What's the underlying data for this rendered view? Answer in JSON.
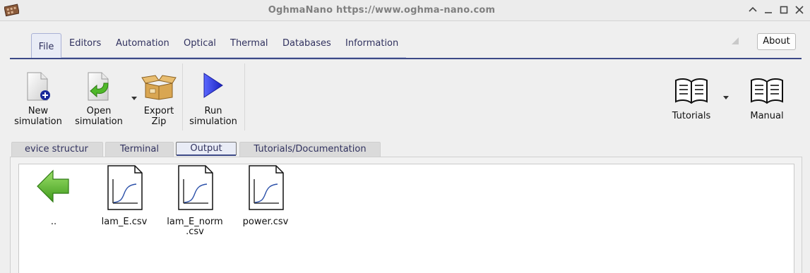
{
  "window": {
    "title": "OghmaNano https://www.oghma-nano.com",
    "controls": [
      "chevron-up-icon",
      "minimize-icon",
      "maximize-icon",
      "close-icon"
    ]
  },
  "menu": {
    "tabs": [
      {
        "label": "File",
        "active": true
      },
      {
        "label": "Editors"
      },
      {
        "label": "Automation"
      },
      {
        "label": "Optical"
      },
      {
        "label": "Thermal"
      },
      {
        "label": "Databases"
      },
      {
        "label": "Information"
      }
    ],
    "about_label": "About"
  },
  "toolbar": {
    "new_line1": "New",
    "new_line2": "simulation",
    "open_line1": "Open",
    "open_line2": "simulation",
    "export_line1": "Export",
    "export_line2": "Zip",
    "run_line1": "Run",
    "run_line2": "simulation",
    "tutorials": "Tutorials",
    "manual": "Manual"
  },
  "subtabs": [
    {
      "label": "evice structur"
    },
    {
      "label": "Terminal"
    },
    {
      "label": "Output",
      "active": true
    },
    {
      "label": "Tutorials/Documentation"
    }
  ],
  "files": [
    {
      "name": "..",
      "icon": "back-arrow-icon"
    },
    {
      "name": "lam_E.csv",
      "icon": "csv-plot-icon"
    },
    {
      "name_line1": "lam_E_norm",
      "name_line2": ".csv",
      "icon": "csv-plot-icon"
    },
    {
      "name": "power.csv",
      "icon": "csv-plot-icon"
    }
  ],
  "colors": {
    "accent": "#3c4987",
    "tab_text": "#31325f",
    "green_arrow": "#58b52c",
    "run_blue": "#2f3bd6"
  }
}
